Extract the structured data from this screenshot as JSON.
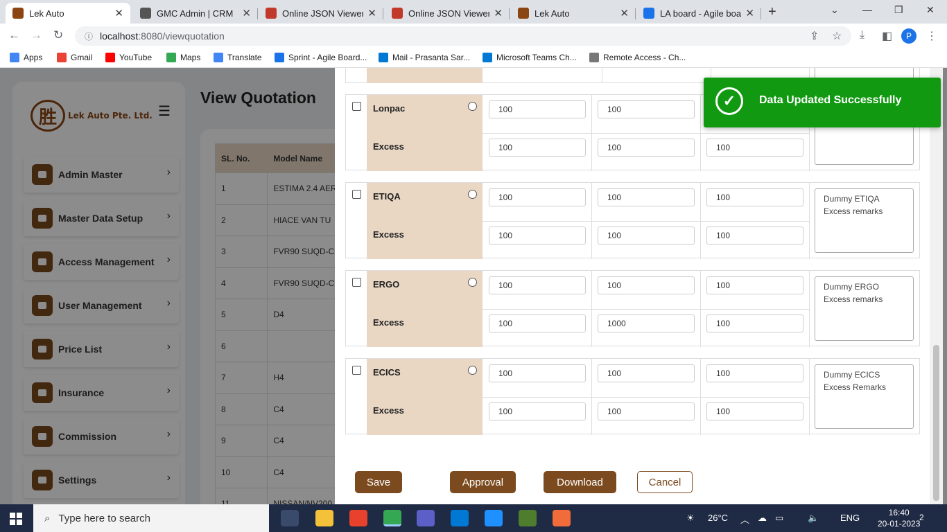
{
  "browser": {
    "tabs": [
      {
        "title": "Lek Auto",
        "color": "#8b4513",
        "active": true
      },
      {
        "title": "GMC Admin | CRM",
        "color": "#555555",
        "active": false
      },
      {
        "title": "Online JSON Viewer",
        "color": "#c0392b",
        "active": false
      },
      {
        "title": "Online JSON Viewer",
        "color": "#c0392b",
        "active": false
      },
      {
        "title": "Lek Auto",
        "color": "#8b4513",
        "active": false
      },
      {
        "title": "LA board - Agile boa",
        "color": "#1a73e8",
        "active": false
      }
    ],
    "new_tab": "+",
    "url_host": "localhost",
    "url_path": ":8080/viewquotation",
    "profile_initial": "P",
    "bookmarks": [
      {
        "label": "Apps",
        "color": "#4285f4"
      },
      {
        "label": "Gmail",
        "color": "#ea4335"
      },
      {
        "label": "YouTube",
        "color": "#ff0000"
      },
      {
        "label": "Maps",
        "color": "#34a853"
      },
      {
        "label": "Translate",
        "color": "#4285f4"
      },
      {
        "label": "Sprint - Agile Board...",
        "color": "#1a73e8"
      },
      {
        "label": "Mail - Prasanta Sar...",
        "color": "#0078d4"
      },
      {
        "label": "Microsoft Teams Ch...",
        "color": "#0078d4"
      },
      {
        "label": "Remote Access - Ch...",
        "color": "#777777"
      }
    ]
  },
  "sidebar": {
    "logo_mark": "胜",
    "logo_text": "Lek Auto Pte. Ltd.",
    "items": [
      {
        "label": "Admin Master",
        "name": "admin-master"
      },
      {
        "label": "Master Data Setup",
        "name": "master-data-setup"
      },
      {
        "label": "Access Management",
        "name": "access-management"
      },
      {
        "label": "User Management",
        "name": "user-management"
      },
      {
        "label": "Price List",
        "name": "price-list"
      },
      {
        "label": "Insurance",
        "name": "insurance"
      },
      {
        "label": "Commission",
        "name": "commission"
      },
      {
        "label": "Settings",
        "name": "settings"
      }
    ]
  },
  "page": {
    "title": "View Quotation",
    "table": {
      "headers": [
        "SL. No.",
        "Model Name"
      ],
      "rows": [
        [
          "1",
          "ESTIMA 2.4 AER"
        ],
        [
          "2",
          "HIACE VAN TU"
        ],
        [
          "3",
          "FVR90 SUQD-C"
        ],
        [
          "4",
          "FVR90 SUQD-C"
        ],
        [
          "5",
          "D4"
        ],
        [
          "6",
          ""
        ],
        [
          "7",
          "H4"
        ],
        [
          "8",
          "C4"
        ],
        [
          "9",
          "C4"
        ],
        [
          "10",
          "C4"
        ],
        [
          "11",
          "NISSAN/NV200"
        ]
      ]
    }
  },
  "modal": {
    "insurers": [
      {
        "name": "Lonpac",
        "excess_label": "Excess",
        "row1": [
          "100",
          "100",
          ""
        ],
        "row2": [
          "100",
          "100",
          "100"
        ],
        "remarks": ""
      },
      {
        "name": "ETIQA",
        "excess_label": "Excess",
        "row1": [
          "100",
          "100",
          "100"
        ],
        "row2": [
          "100",
          "100",
          "100"
        ],
        "remarks": "Dummy ETIQA Excess remarks"
      },
      {
        "name": "ERGO",
        "excess_label": "Excess",
        "row1": [
          "100",
          "100",
          "100"
        ],
        "row2": [
          "100",
          "1000",
          "100"
        ],
        "remarks": "Dummy ERGO Excess remarks"
      },
      {
        "name": "ECICS",
        "excess_label": "Excess",
        "row1": [
          "100",
          "100",
          "100"
        ],
        "row2": [
          "100",
          "100",
          "100"
        ],
        "remarks": "Dummy ECICS Excess Remarks"
      }
    ],
    "buttons": {
      "save": "Save",
      "approval": "Approval",
      "download": "Download",
      "cancel": "Cancel"
    }
  },
  "toast": {
    "message": "Data Updated Successfully",
    "icon": "check-circle-icon"
  },
  "taskbar": {
    "search_placeholder": "Type here to search",
    "weather": "26°C",
    "language": "ENG",
    "time": "16:40",
    "date": "20-01-2023",
    "notifications": "2"
  }
}
